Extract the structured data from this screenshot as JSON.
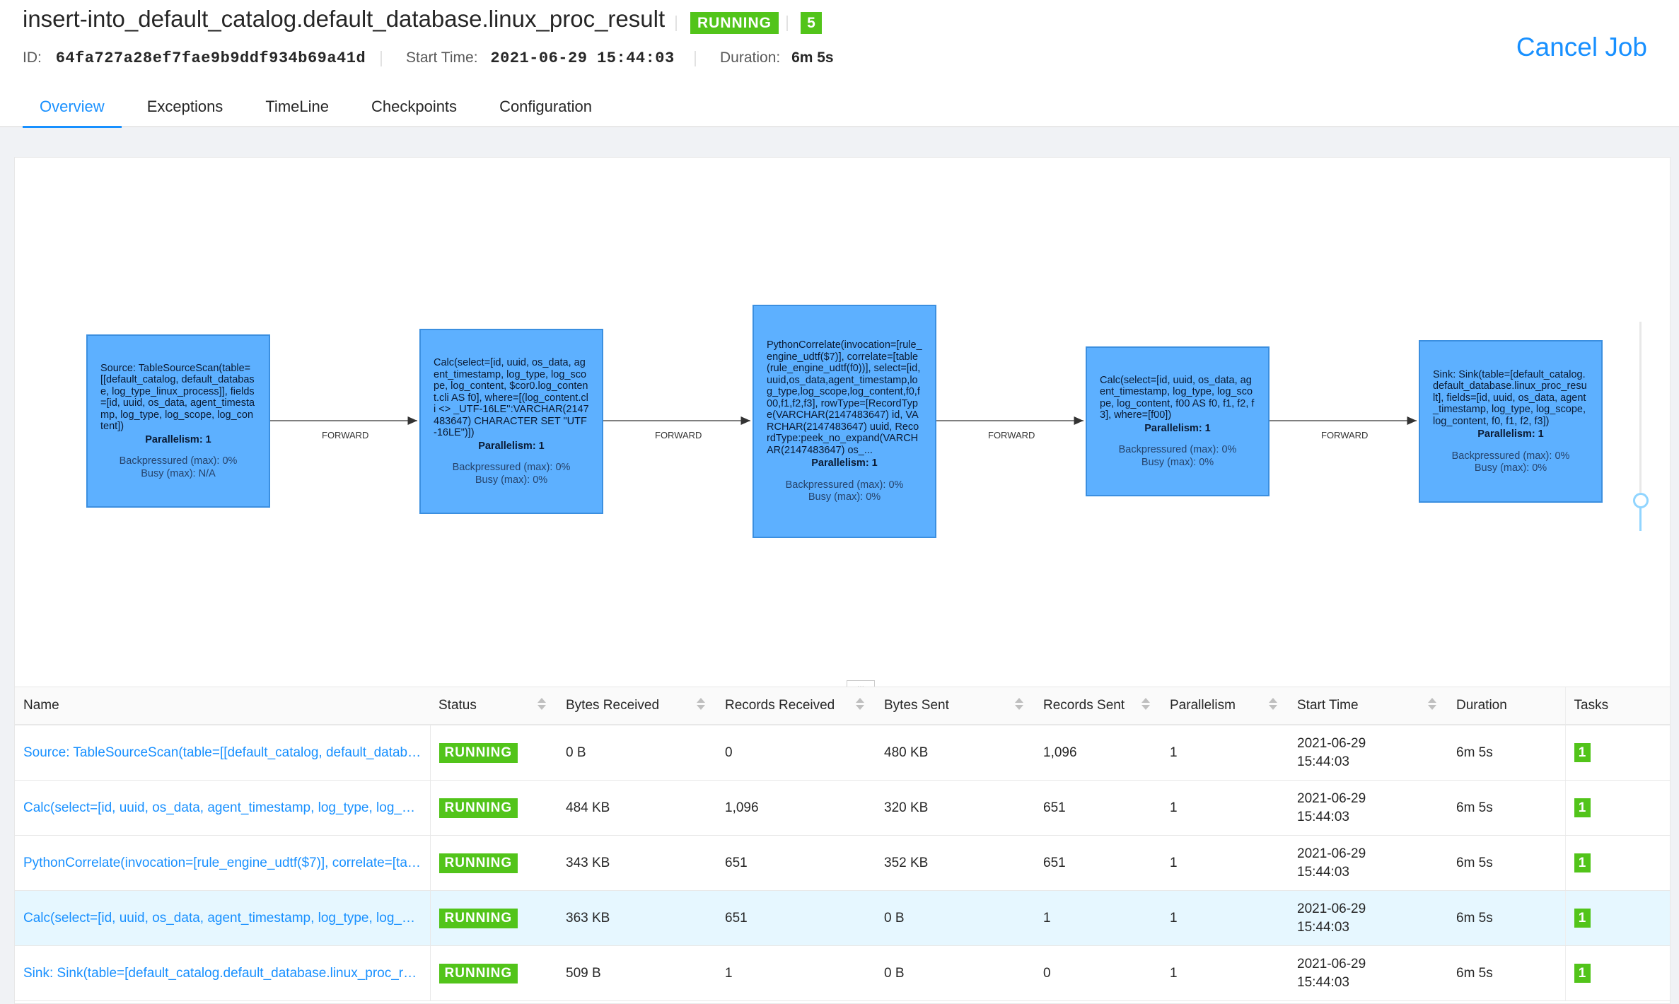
{
  "job": {
    "title": "insert-into_default_catalog.default_database.linux_proc_result",
    "status": "RUNNING",
    "task_count": "5",
    "id_label": "ID:",
    "id": "64fa727a28ef7fae9b9ddf934b69a41d",
    "start_label": "Start Time:",
    "start_time": "2021-06-29 15:44:03",
    "duration_label": "Duration:",
    "duration": "6m 5s",
    "cancel_label": "Cancel Job"
  },
  "tabs": [
    "Overview",
    "Exceptions",
    "TimeLine",
    "Checkpoints",
    "Configuration"
  ],
  "graph": {
    "edge_label": "FORWARD",
    "nodes": [
      {
        "desc": "Source: TableSourceScan(table=[[default_catalog, default_database, log_type_linux_process]], fields=[id, uuid, os_data, agent_timestamp, log_type, log_scope, log_content])",
        "parallelism": "Parallelism: 1",
        "backpressured": "Backpressured (max): 0%",
        "busy": "Busy (max): N/A"
      },
      {
        "desc": "Calc(select=[id, uuid, os_data, agent_timestamp, log_type, log_scope, log_content, $cor0.log_content.cli AS f0], where=[(log_content.cli <> _UTF-16LE'':VARCHAR(2147483647) CHARACTER SET \"UTF-16LE\")])",
        "parallelism": "Parallelism: 1",
        "backpressured": "Backpressured (max): 0%",
        "busy": "Busy (max): 0%"
      },
      {
        "desc": "PythonCorrelate(invocation=[rule_engine_udtf($7)], correlate=[table(rule_engine_udtf(f0))], select=[id,uuid,os_data,agent_timestamp,log_type,log_scope,log_content,f0,f00,f1,f2,f3], rowType=[RecordType(VARCHAR(2147483647) id, VARCHAR(2147483647) uuid, RecordType:peek_no_expand(VARCHAR(2147483647) os_...",
        "parallelism": "Parallelism: 1",
        "backpressured": "Backpressured (max): 0%",
        "busy": "Busy (max): 0%"
      },
      {
        "desc": "Calc(select=[id, uuid, os_data, agent_timestamp, log_type, log_scope, log_content, f00 AS f0, f1, f2, f3], where=[f00])",
        "parallelism": "Parallelism: 1",
        "backpressured": "Backpressured (max): 0%",
        "busy": "Busy (max): 0%"
      },
      {
        "desc": "Sink: Sink(table=[default_catalog.default_database.linux_proc_result], fields=[id, uuid, os_data, agent_timestamp, log_type, log_scope, log_content, f0, f1, f2, f3])",
        "parallelism": "Parallelism: 1",
        "backpressured": "Backpressured (max): 0%",
        "busy": "Busy (max): 0%"
      }
    ]
  },
  "resize_handle": "...",
  "table": {
    "columns": [
      "Name",
      "Status",
      "Bytes Received",
      "Records Received",
      "Bytes Sent",
      "Records Sent",
      "Parallelism",
      "Start Time",
      "Duration",
      "Tasks"
    ],
    "rows": [
      {
        "name": "Source: TableSourceScan(table=[[default_catalog, default_database, log_type_linux_process]], fields=[id, uuid, os_data, agent_timestamp, log_type, log_scope, log_content])",
        "status": "RUNNING",
        "bytes_received": "0 B",
        "records_received": "0",
        "bytes_sent": "480 KB",
        "records_sent": "1,096",
        "parallelism": "1",
        "start_date": "2021-06-29",
        "start_clock": "15:44:03",
        "duration": "6m 5s",
        "tasks": "1"
      },
      {
        "name": "Calc(select=[id, uuid, os_data, agent_timestamp, log_type, log_scope, log_content, $cor0.log_content.cli AS f0], where=[(log_content.cli <> _UTF-16LE'':VARCHAR(2147483647) CHARACTER SET \"UTF-16LE\")])",
        "status": "RUNNING",
        "bytes_received": "484 KB",
        "records_received": "1,096",
        "bytes_sent": "320 KB",
        "records_sent": "651",
        "parallelism": "1",
        "start_date": "2021-06-29",
        "start_clock": "15:44:03",
        "duration": "6m 5s",
        "tasks": "1"
      },
      {
        "name": "PythonCorrelate(invocation=[rule_engine_udtf($7)], correlate=[table(rule_engine_udtf(f0))], select=[id,uuid,os_data,agent_timestamp,log_type,log_scope,log_content,f0,f00,f1,f2,f3])",
        "status": "RUNNING",
        "bytes_received": "343 KB",
        "records_received": "651",
        "bytes_sent": "352 KB",
        "records_sent": "651",
        "parallelism": "1",
        "start_date": "2021-06-29",
        "start_clock": "15:44:03",
        "duration": "6m 5s",
        "tasks": "1"
      },
      {
        "name": "Calc(select=[id, uuid, os_data, agent_timestamp, log_type, log_scope, log_content, f00 AS f0, f1, f2, f3], where=[f00])",
        "status": "RUNNING",
        "bytes_received": "363 KB",
        "records_received": "651",
        "bytes_sent": "0 B",
        "records_sent": "1",
        "parallelism": "1",
        "start_date": "2021-06-29",
        "start_clock": "15:44:03",
        "duration": "6m 5s",
        "tasks": "1"
      },
      {
        "name": "Sink: Sink(table=[default_catalog.default_database.linux_proc_result], fields=[id, uuid, os_data, agent_timestamp, log_type, log_scope, log_content, f0, f1, f2, f3])",
        "status": "RUNNING",
        "bytes_received": "509 B",
        "records_received": "1",
        "bytes_sent": "0 B",
        "records_sent": "0",
        "parallelism": "1",
        "start_date": "2021-06-29",
        "start_clock": "15:44:03",
        "duration": "6m 5s",
        "tasks": "1"
      }
    ]
  },
  "colors": {
    "accent": "#1890ff",
    "running": "#52c41a",
    "node_fill": "#5db0ff",
    "row_highlight": "#e6f7ff"
  }
}
